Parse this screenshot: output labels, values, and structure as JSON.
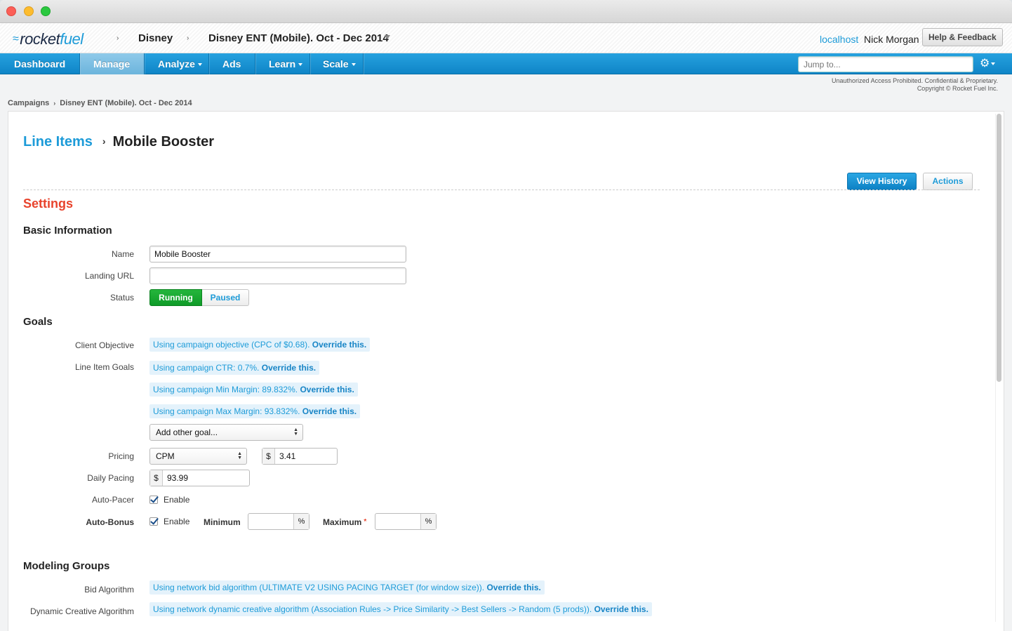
{
  "header": {
    "logo_prefix": "rocket",
    "logo_suffix": "fuel",
    "crumb_advertiser": "Disney",
    "crumb_campaign": "Disney ENT (Mobile). Oct - Dec 2014",
    "host": "localhost",
    "user": "Nick Morgan",
    "help_label": "Help & Feedback"
  },
  "nav": {
    "items": [
      {
        "label": "Dashboard"
      },
      {
        "label": "Manage"
      },
      {
        "label": "Analyze"
      },
      {
        "label": "Ads"
      },
      {
        "label": "Learn"
      },
      {
        "label": "Scale"
      }
    ],
    "active": "Manage",
    "jump_placeholder": "Jump to...",
    "settings_icon": "gear-icon"
  },
  "legal": {
    "line1": "Unauthorized Access Prohibited. Confidential & Proprietary.",
    "line2": "Copyright © Rocket Fuel Inc."
  },
  "breadcrumb": {
    "root": "Campaigns",
    "current": "Disney ENT (Mobile). Oct - Dec 2014"
  },
  "page": {
    "title_link": "Line Items",
    "title_current": "Mobile Booster",
    "view_history": "View History",
    "actions": "Actions",
    "settings_heading": "Settings"
  },
  "basic": {
    "heading": "Basic Information",
    "name_label": "Name",
    "name_value": "Mobile Booster",
    "url_label": "Landing URL",
    "url_value": "",
    "status_label": "Status",
    "status_running": "Running",
    "status_paused": "Paused"
  },
  "goals": {
    "heading": "Goals",
    "client_objective_label": "Client Objective",
    "client_objective_text": "Using campaign objective (CPC of $0.68).",
    "line_item_goals_label": "Line Item Goals",
    "goal_ctr": "Using campaign CTR: 0.7%.",
    "goal_min_margin": "Using campaign Min Margin: 89.832%.",
    "goal_max_margin": "Using campaign Max Margin: 93.832%.",
    "override": "Override this.",
    "add_goal": "Add other goal...",
    "pricing_label": "Pricing",
    "pricing_type": "CPM",
    "currency": "$",
    "pricing_value": "3.41",
    "daily_pacing_label": "Daily Pacing",
    "daily_pacing_value": "93.99",
    "autopacer_label": "Auto-Pacer",
    "enable": "Enable",
    "autobonus_label": "Auto-Bonus",
    "minimum": "Minimum",
    "maximum": "Maximum",
    "required_mark": "*",
    "percent": "%"
  },
  "modeling": {
    "heading": "Modeling Groups",
    "bid_label": "Bid Algorithm",
    "bid_text": "Using network bid algorithm (ULTIMATE V2 USING PACING TARGET (for window size)).",
    "dca_label": "Dynamic Creative Algorithm",
    "dca_text": "Using network dynamic creative algorithm (Association Rules -> Price Similarity -> Best Sellers -> Random (5 prods)).",
    "override": "Override this."
  }
}
